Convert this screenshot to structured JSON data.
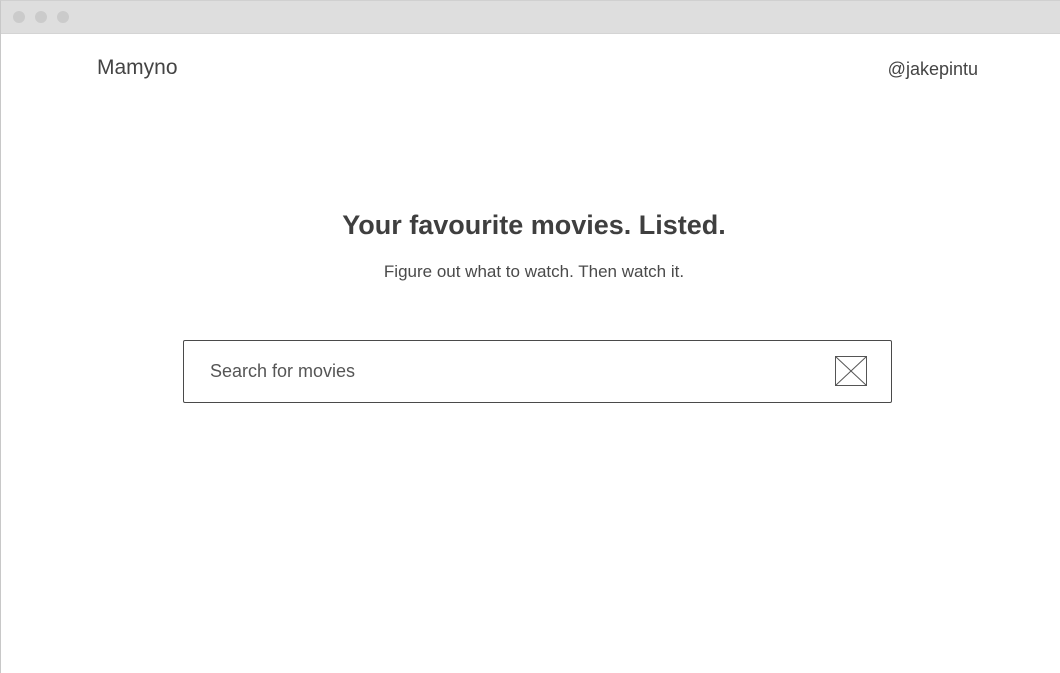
{
  "header": {
    "brand": "Mamyno",
    "user_handle": "@jakepintu"
  },
  "hero": {
    "title": "Your favourite movies. Listed.",
    "subtitle": "Figure out what to watch. Then watch it."
  },
  "search": {
    "placeholder": "Search for movies",
    "value": "",
    "button_icon": "image-placeholder-icon"
  },
  "colors": {
    "text": "#444444",
    "titlebar": "#dedede",
    "border": "#4a4a4a"
  }
}
